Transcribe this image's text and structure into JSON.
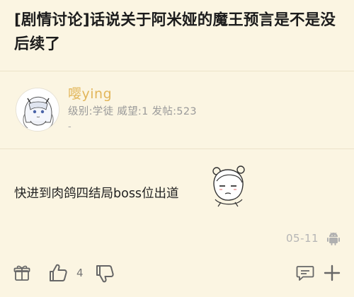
{
  "thread": {
    "title": "[剧情讨论]话说关于阿米娅的魔王预言是不是没后续了"
  },
  "post": {
    "author": {
      "username": "嘤ying",
      "meta": "级别:学徒 威望:1 发帖:523",
      "signature": "-"
    },
    "content": "快进到肉鸽四结局boss位出道",
    "date": "05-11",
    "like_count": "4"
  },
  "icons": {
    "gift": "gift-icon",
    "like": "thumbs-up-icon",
    "dislike": "thumbs-down-icon",
    "comment": "comment-icon",
    "add": "plus-icon",
    "platform": "android-icon"
  },
  "colors": {
    "background": "#fbf5e2",
    "username": "#e2b65a",
    "icon": "#666666"
  }
}
